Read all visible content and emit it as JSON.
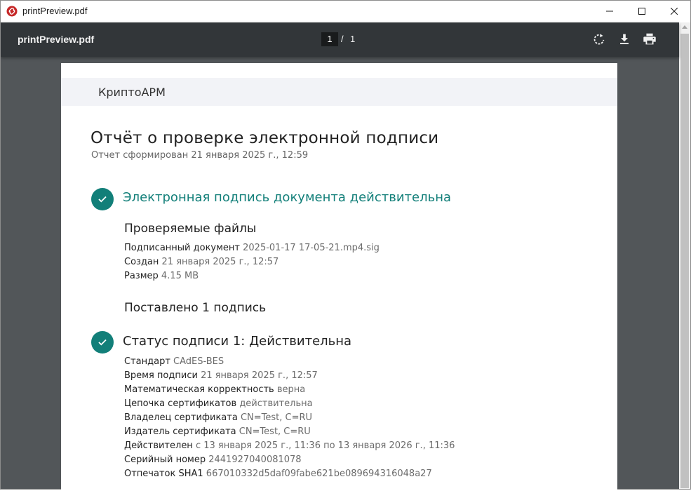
{
  "window": {
    "title": "printPreview.pdf"
  },
  "viewer": {
    "filename": "printPreview.pdf",
    "current_page": "1",
    "separator": "/",
    "total_pages": "1",
    "icons": [
      "rotate-icon",
      "download-icon",
      "print-icon"
    ]
  },
  "report": {
    "brand": "КриптоАРМ",
    "title": "Отчёт о проверке электронной подписи",
    "subtitle": "Отчет сформирован 21 января 2025 г., 12:59",
    "status": "Электронная подпись документа действительна",
    "files_heading": "Проверяемые файлы",
    "files": [
      {
        "label": "Подписанный документ",
        "value": "2025-01-17 17-05-21.mp4.sig"
      },
      {
        "label": "Создан",
        "value": "21 января 2025 г., 12:57"
      },
      {
        "label": "Размер",
        "value": "4.15 MB"
      }
    ],
    "signature_count": "Поставлено 1 подпись",
    "signature_status": "Статус подписи 1: Действительна",
    "signature_details": [
      {
        "label": "Стандарт",
        "value": "CAdES-BES"
      },
      {
        "label": "Время подписи",
        "value": "21 января 2025 г., 12:57"
      },
      {
        "label": "Математическая корректность",
        "value": "верна"
      },
      {
        "label": "Цепочка сертификатов",
        "value": "действительна"
      },
      {
        "label": "Владелец сертификата",
        "value": "CN=Test, C=RU"
      },
      {
        "label": "Издатель сертификата",
        "value": "CN=Test, C=RU"
      },
      {
        "label": "Действителен",
        "value": "с 13 января 2025 г., 11:36 по 13 января 2026 г., 11:36"
      },
      {
        "label": "Серийный номер",
        "value": "2441927040081078"
      },
      {
        "label": "Отпечаток SHA1",
        "value": "667010332d5daf09fabe621be089694316048a27"
      }
    ]
  },
  "colors": {
    "accent": "#127f79",
    "toolbar": "#323639",
    "viewer_background": "#525659"
  }
}
